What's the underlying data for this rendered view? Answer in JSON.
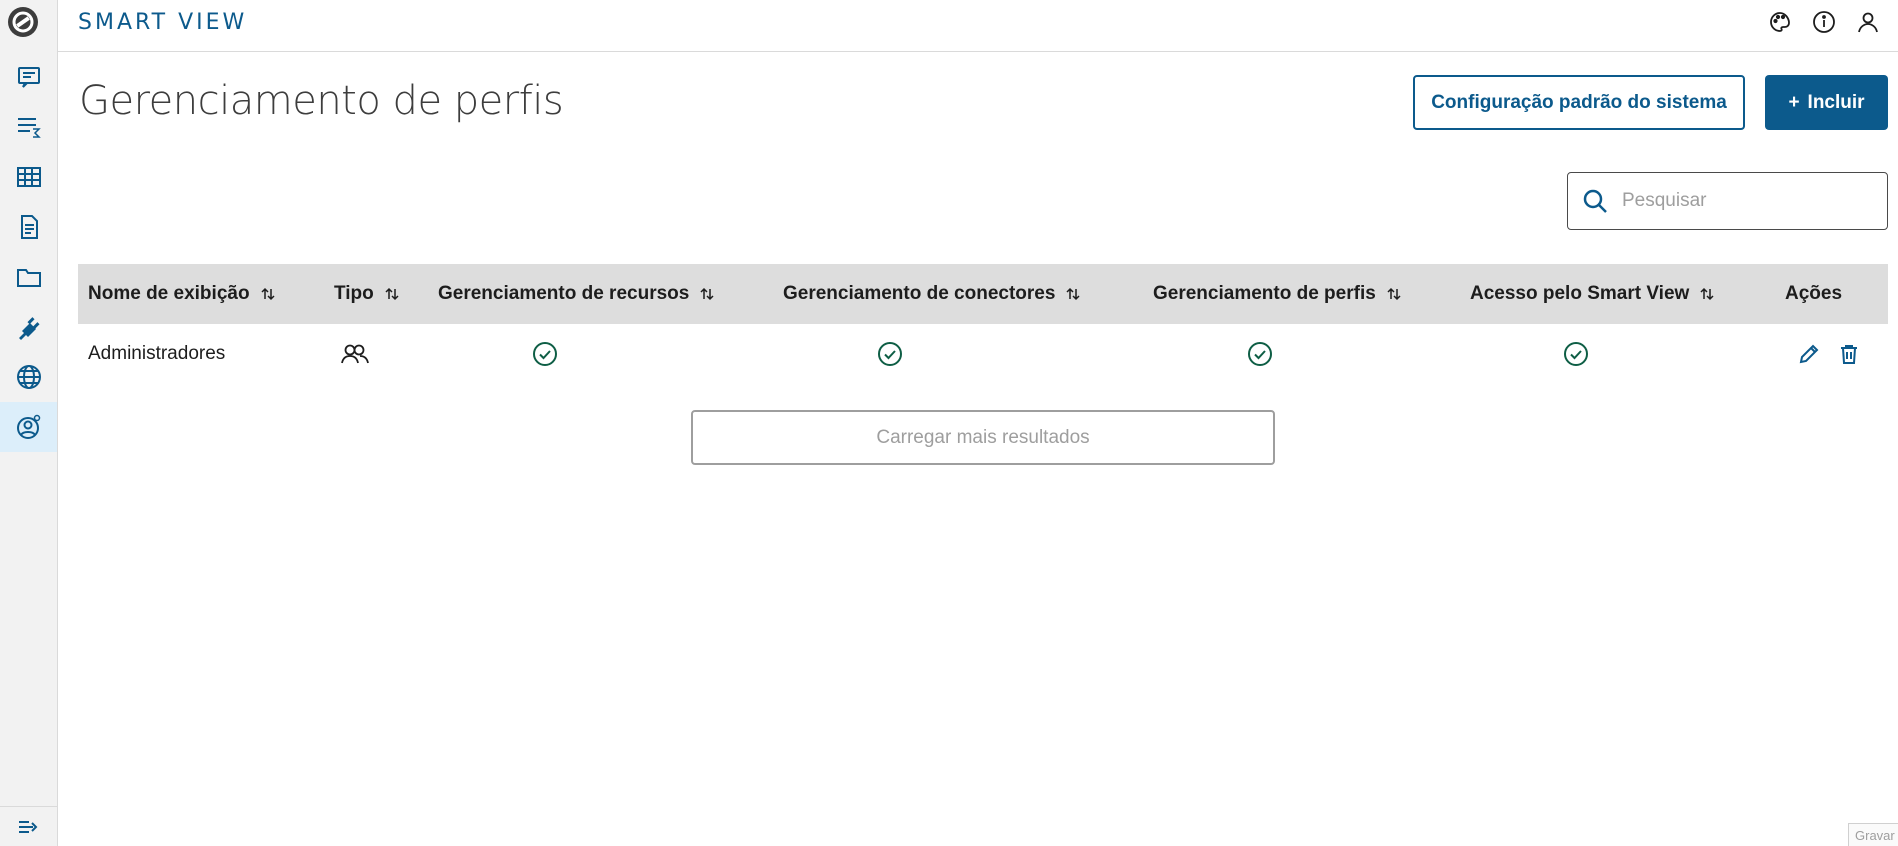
{
  "app": {
    "brand": "SMART VIEW"
  },
  "colors": {
    "primary": "#0c5a8c",
    "check": "#0e5e45",
    "sidebar_bg": "#f2f2f2",
    "header_bg": "#dddddd"
  },
  "sidebar": {
    "logo_icon": "totvs-logo-icon",
    "items": [
      {
        "icon": "report-icon"
      },
      {
        "icon": "data-sum-icon"
      },
      {
        "icon": "table-icon"
      },
      {
        "icon": "document-icon"
      },
      {
        "icon": "folder-icon"
      },
      {
        "icon": "plug-icon"
      },
      {
        "icon": "globe-icon"
      },
      {
        "icon": "user-gear-icon",
        "active": true
      }
    ],
    "collapse_icon": "menu-collapse-icon"
  },
  "topbar": {
    "icons": [
      "palette-icon",
      "info-icon",
      "user-icon"
    ]
  },
  "main": {
    "title": "Gerenciamento de perfis",
    "config_button": "Configuração padrão do sistema",
    "add_button": "Incluir",
    "add_button_prefix": "+",
    "search": {
      "placeholder": "Pesquisar"
    },
    "table": {
      "columns": [
        {
          "label": "Nome de exibição",
          "sortable": true
        },
        {
          "label": "Tipo",
          "sortable": true
        },
        {
          "label": "Gerenciamento de recursos",
          "sortable": true
        },
        {
          "label": "Gerenciamento de conectores",
          "sortable": true
        },
        {
          "label": "Gerenciamento de perfis",
          "sortable": true
        },
        {
          "label": "Acesso pelo Smart View",
          "sortable": true
        },
        {
          "label": "Ações",
          "sortable": false
        }
      ],
      "rows": [
        {
          "name": "Administradores",
          "type_icon": "group-icon",
          "resources": true,
          "connectors": true,
          "profiles": true,
          "smart_view_access": true,
          "actions": [
            "edit-icon",
            "trash-icon"
          ]
        }
      ]
    },
    "load_more": "Carregar mais resultados"
  },
  "corner": {
    "label": "Gravar"
  }
}
